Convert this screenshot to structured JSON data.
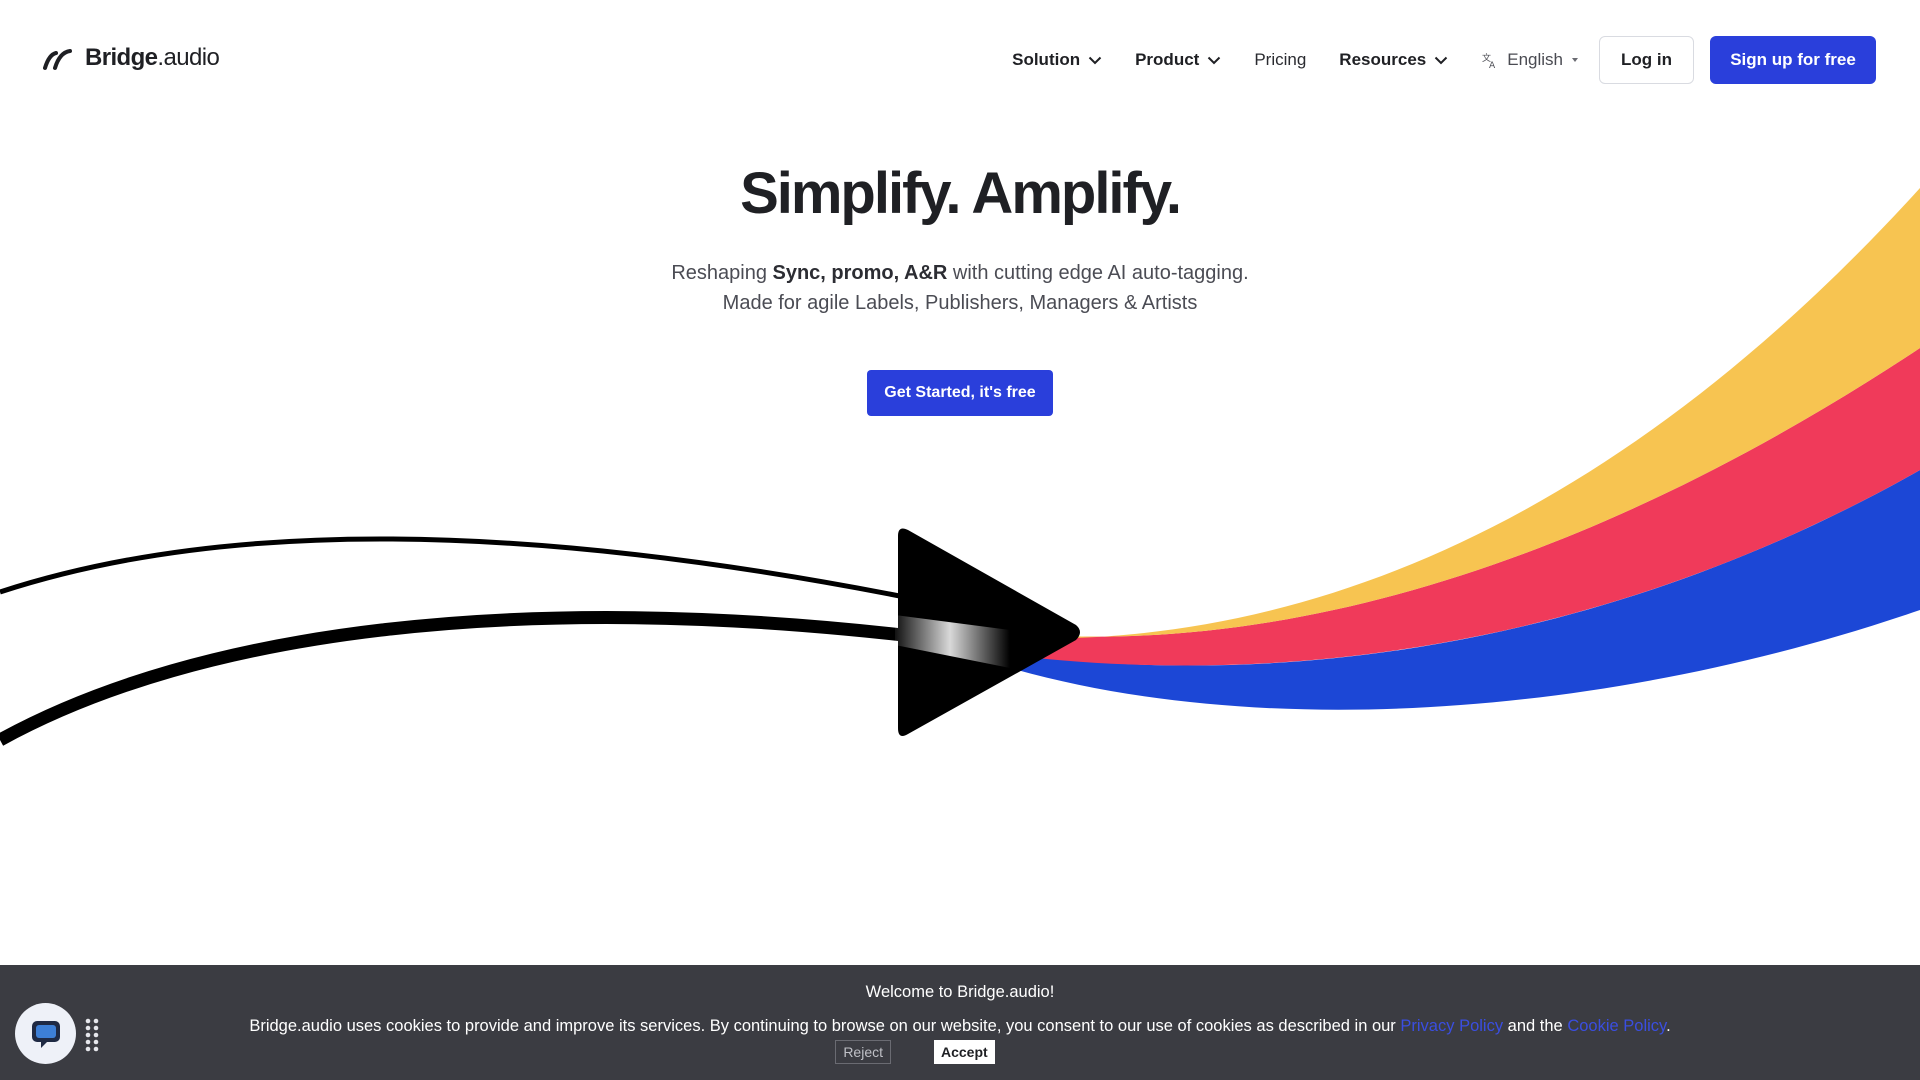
{
  "brand": {
    "name_bold": "Bridge",
    "name_rest": ".audio"
  },
  "nav": {
    "items": [
      {
        "label": "Solution",
        "has_dropdown": true
      },
      {
        "label": "Product",
        "has_dropdown": true
      },
      {
        "label": "Pricing",
        "has_dropdown": false
      },
      {
        "label": "Resources",
        "has_dropdown": true
      }
    ],
    "language": {
      "label": "English",
      "icon": "translate-icon"
    },
    "login_label": "Log in",
    "signup_label": "Sign up for free"
  },
  "hero": {
    "title": "Simplify. Amplify.",
    "sub_line1_pre": "Reshaping ",
    "sub_line1_bold": "Sync, promo, A&R",
    "sub_line1_post": " with cutting edge AI auto-tagging.",
    "sub_line2": "Made for agile Labels, Publishers, Managers & Artists",
    "cta_label": "Get Started, it's free"
  },
  "colors": {
    "accent": "#2a3fdb",
    "stripe_yellow": "#f7c451",
    "stripe_red": "#f03a5a",
    "stripe_blue": "#1c47d6",
    "cookie_bg": "#3b3c42"
  },
  "cookie": {
    "title": "Welcome to Bridge.audio!",
    "text_pre": "Bridge.audio uses cookies to provide and improve its services. By continuing to browse on our website, you consent to our use of cookies as described in our ",
    "privacy_link": "Privacy Policy",
    "text_mid": " and the ",
    "cookie_link": "Cookie Policy",
    "text_post": ".",
    "reject_label": "Reject",
    "accept_label": "Accept"
  },
  "widgets": {
    "chat_icon": "chat-icon",
    "drag_icon": "drag-handle-icon"
  }
}
